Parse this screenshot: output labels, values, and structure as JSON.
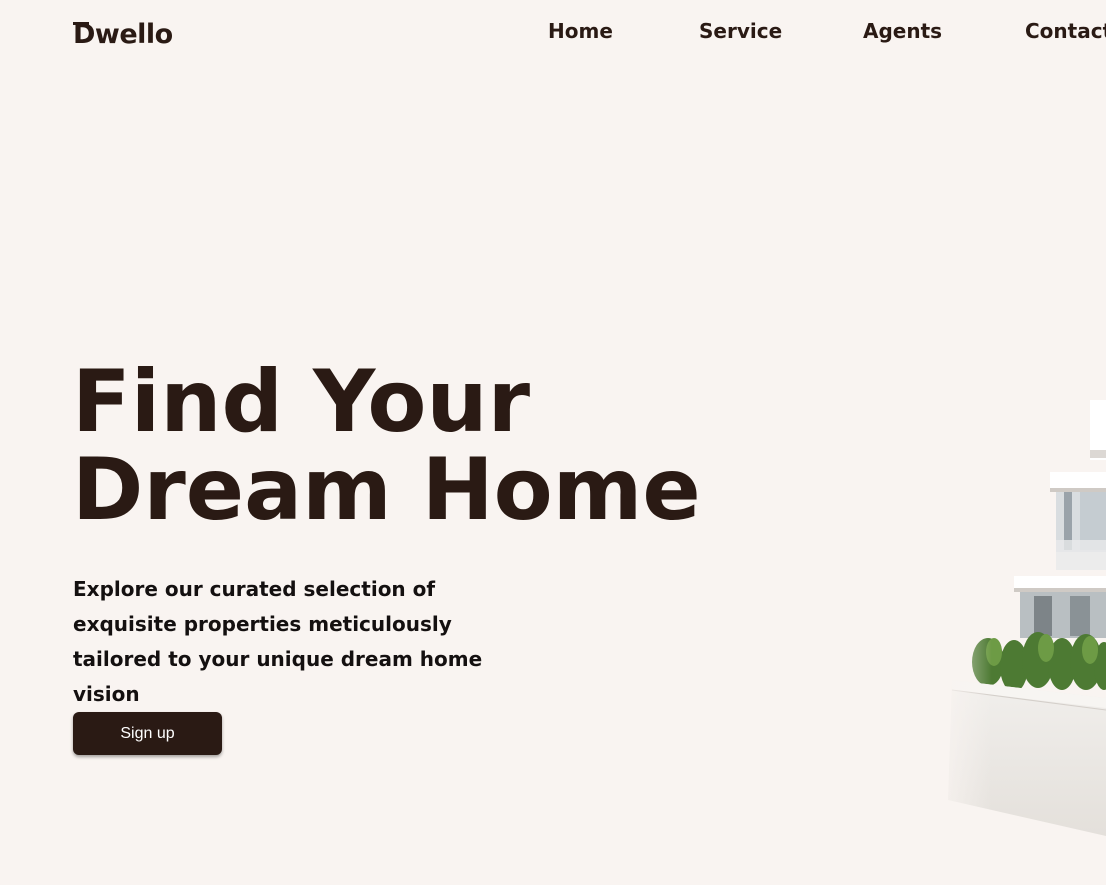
{
  "header": {
    "logo_text": "Dwello",
    "nav": {
      "home": "Home",
      "service": "Service",
      "agents": "Agents",
      "contact": "Contact"
    }
  },
  "hero": {
    "title_line1": "Find Your",
    "title_line2": "Dream Home",
    "subtitle": "Explore our curated selection of exquisite properties meticulously tailored to your unique dream home vision",
    "cta_label": "Sign up"
  },
  "colors": {
    "background": "#f9f4f1",
    "brand_dark": "#2a1a14",
    "button_text": "#ffffff"
  },
  "icons": {
    "logo": "dwello-logo-icon",
    "house": "modern-house-image"
  }
}
